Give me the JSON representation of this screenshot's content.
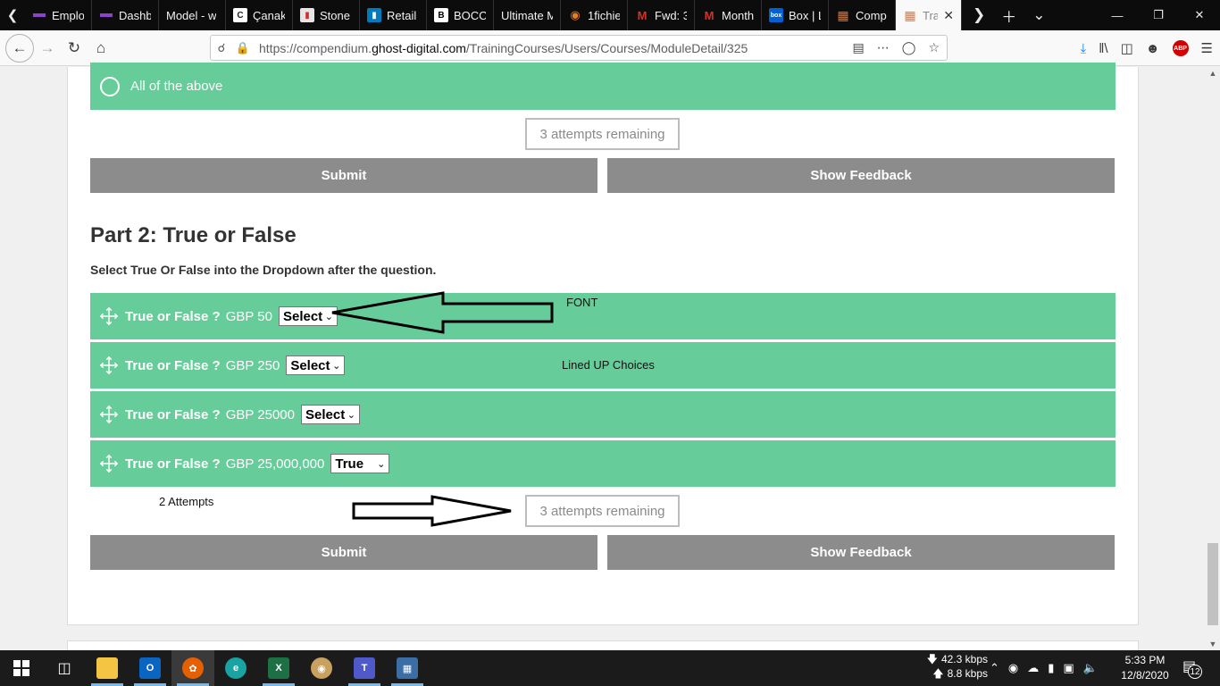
{
  "browser": {
    "tabs": [
      {
        "label": "Emplo",
        "icon": "purple-bar-icon",
        "icon_color": "#8a44c8"
      },
      {
        "label": "Dashb",
        "icon": "purple-bar-icon",
        "icon_color": "#8a44c8"
      },
      {
        "label": "Model - w",
        "icon": "none",
        "icon_color": "#0c0c0d"
      },
      {
        "label": "Çanak",
        "icon": "c-logo-icon",
        "icon_color": "#444"
      },
      {
        "label": "Stone",
        "icon": "trello-icon",
        "icon_color": "#e5e5e5"
      },
      {
        "label": "Retail",
        "icon": "trello-icon",
        "icon_color": "#0079bf"
      },
      {
        "label": "BOCC",
        "icon": "b-logo-icon",
        "icon_color": "#222"
      },
      {
        "label": "Ultimate M",
        "icon": "none",
        "icon_color": "#0c0c0d"
      },
      {
        "label": "1fichie",
        "icon": "fichier-icon",
        "icon_color": "#c0392b"
      },
      {
        "label": "Fwd: 3",
        "icon": "gmail-icon",
        "icon_color": "#d93025"
      },
      {
        "label": "Month",
        "icon": "gmail-icon",
        "icon_color": "#d93025"
      },
      {
        "label": "Box | L",
        "icon": "box-icon",
        "icon_color": "#0061d5"
      },
      {
        "label": "Comp",
        "icon": "grid-dots-icon",
        "icon_color": "#f37021"
      },
      {
        "label": "Tra",
        "icon": "grid-dots-icon",
        "icon_color": "#f37021",
        "active": true
      }
    ],
    "url_prefix": "https://compendium.",
    "url_domain": "ghost-digital.com",
    "url_path": "/TrainingCourses/Users/Courses/ModuleDetail/325"
  },
  "part1": {
    "last_option": "All of the above",
    "attempts_label": "3 attempts remaining",
    "submit_label": "Submit",
    "feedback_label": "Show Feedback"
  },
  "part2": {
    "title": "Part 2: True or False",
    "instructions": "Select True Or False into the Dropdown after the question.",
    "questions": [
      {
        "label": "True or False ?",
        "amount": "GBP 50",
        "selected": "Select"
      },
      {
        "label": "True or False ?",
        "amount": "GBP 250",
        "selected": "Select"
      },
      {
        "label": "True or False ?",
        "amount": "GBP 25000",
        "selected": "Select"
      },
      {
        "label": "True or False ?",
        "amount": "GBP 25,000,000",
        "selected": "True"
      }
    ],
    "attempts_label": "3 attempts remaining",
    "submit_label": "Submit",
    "feedback_label": "Show Feedback"
  },
  "annotations": {
    "font_note": "FONT",
    "lined_up_note": "Lined UP Choices",
    "attempts_note": "2 Attempts"
  },
  "taskbar": {
    "net_down": "42.3 kbps",
    "net_up": "8.8 kbps",
    "time": "5:33 PM",
    "date": "12/8/2020",
    "notifications": "12"
  },
  "colors": {
    "green_row": "#66cc99",
    "button_gray": "#8c8c8c"
  }
}
